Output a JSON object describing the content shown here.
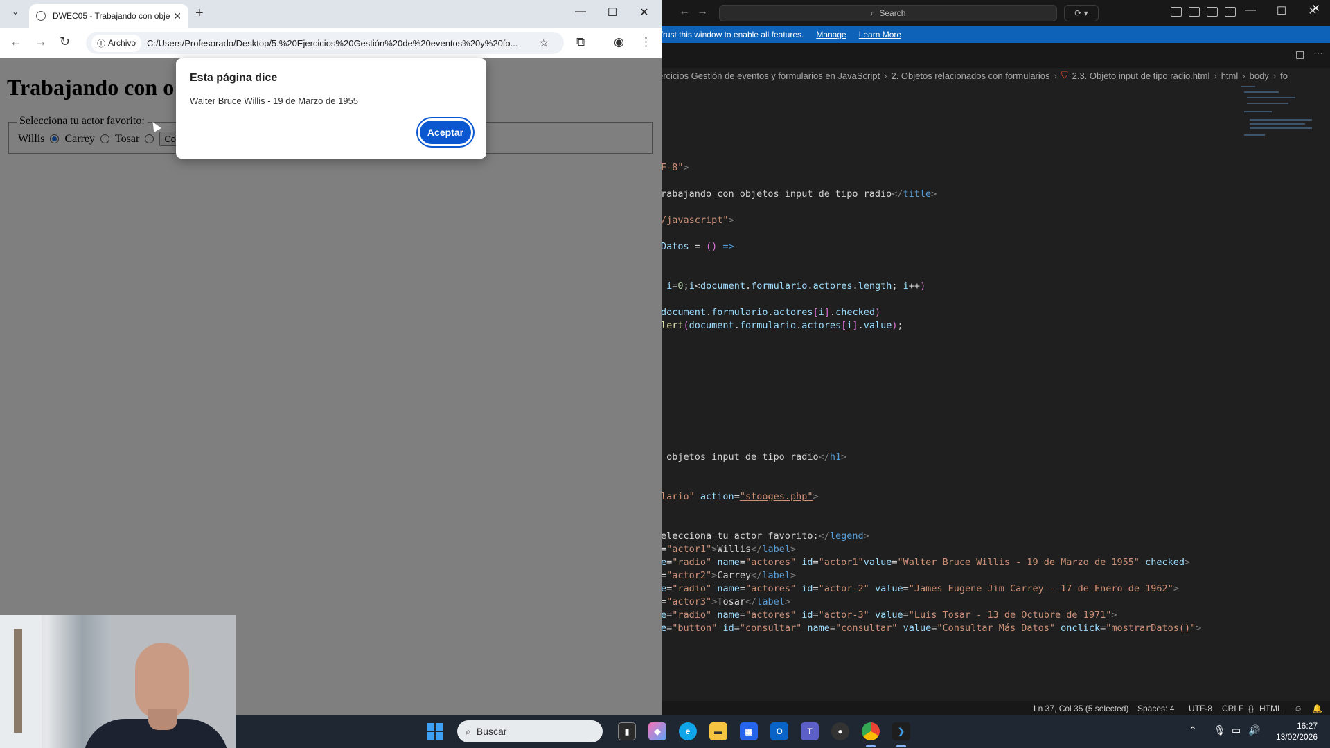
{
  "vscode": {
    "search_placeholder": "Search",
    "banner": {
      "text": "Trust this window to enable all features.",
      "manage": "Manage",
      "learn_more": "Learn More"
    },
    "breadcrumb": [
      "ercicios Gestión de eventos y formularios en JavaScript",
      "2. Objetos relacionados con formularios",
      "2.3. Objeto input de tipo radio.html",
      "html",
      "body",
      "fo"
    ],
    "status": {
      "position": "Ln 37, Col 35 (5 selected)",
      "spaces": "Spaces: 4",
      "encoding": "UTF-8",
      "eol": "CRLF",
      "language": "HTML"
    }
  },
  "chrome": {
    "tab_title": "DWEC05 - Trabajando con obje",
    "site_chip": "Archivo",
    "url": "C:/Users/Profesorado/Desktop/5.%20Ejercicios%20Gestión%20de%20eventos%20y%20fo..."
  },
  "page": {
    "title": "Trabajando con o",
    "legend": "Selecciona tu actor favorito:",
    "labels": [
      "Willis",
      "Carrey",
      "Tosar"
    ],
    "button_partial": "Co"
  },
  "dialog": {
    "title": "Esta página dice",
    "message": "Walter Bruce Willis - 19 de Marzo de 1955",
    "ok": "Aceptar"
  },
  "taskbar": {
    "search": "Buscar",
    "time": "16:27",
    "date": "13/02/2026"
  },
  "colors": {
    "vscode_banner": "#0e63b8",
    "dialog_button": "#0b57d0",
    "taskbar": "#1f2732"
  }
}
